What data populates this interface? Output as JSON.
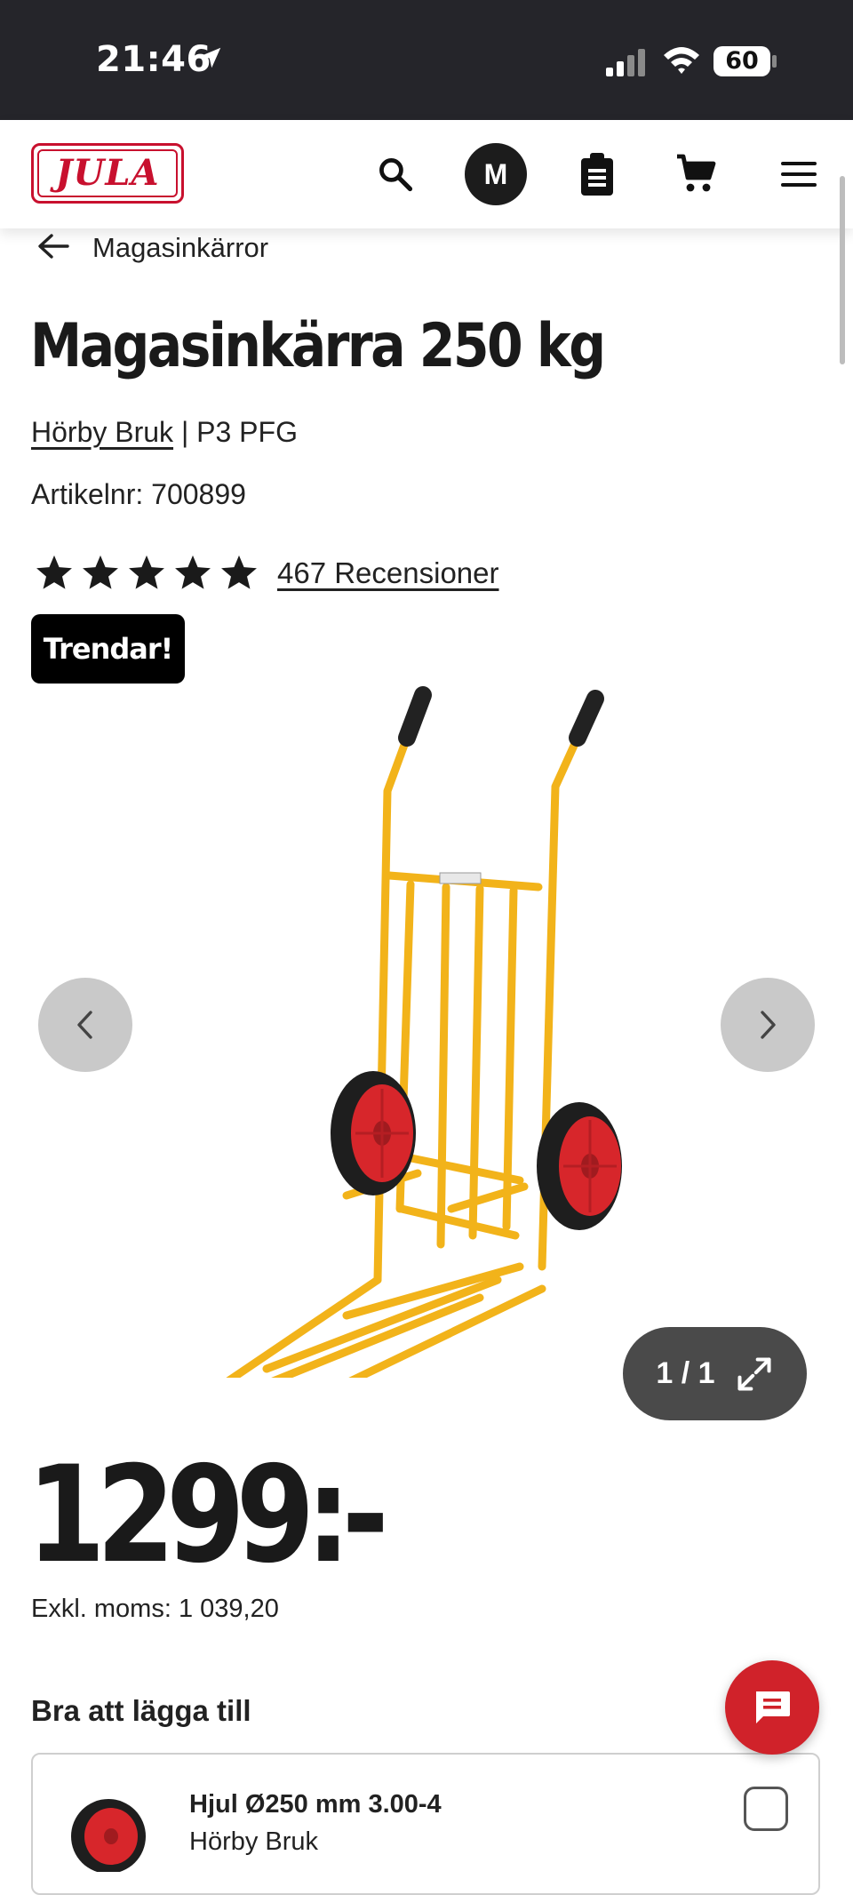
{
  "status_bar": {
    "time": "21:46",
    "battery": "60"
  },
  "header": {
    "logo_text": "JULA",
    "avatar_initial": "M"
  },
  "breadcrumb": {
    "label": "Magasinkärror"
  },
  "product": {
    "title": "Magasinkärra 250 kg",
    "brand": "Hörby Bruk",
    "brand_separator": " | P3 PFG",
    "article_number": "Artikelnr: 700899",
    "rating_stars": 5,
    "reviews": "467 Recensioner",
    "badge": "Trendar!",
    "image_counter": "1 / 1",
    "price": "1299:-",
    "price_excl_vat": "Exkl. moms: 1 039,20"
  },
  "addons": {
    "title": "Bra att lägga till",
    "items": [
      {
        "name": "Hjul Ø250 mm 3.00-4",
        "brand": "Hörby Bruk",
        "checked": false
      }
    ]
  },
  "colors": {
    "brand_red": "#c8102e",
    "status_bar": "#25252a",
    "trolley_yellow": "#f5b817",
    "wheel_red": "#d7262b"
  }
}
